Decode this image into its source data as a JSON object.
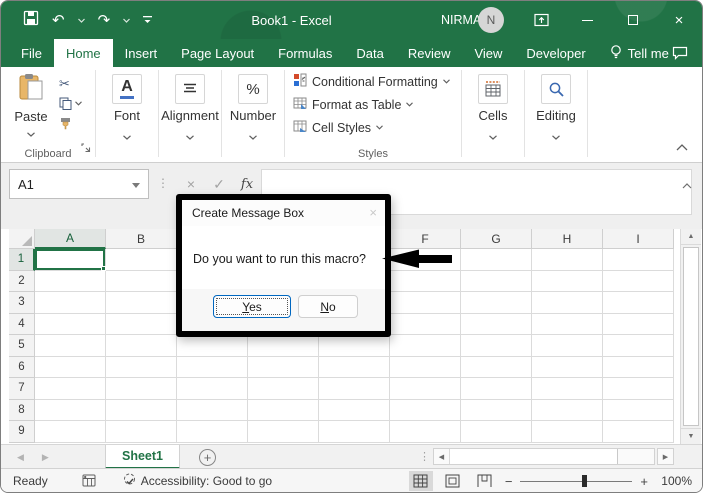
{
  "titlebar": {
    "title": "Book1 - Excel",
    "user": "NIRMAL",
    "avatar": "N"
  },
  "tabs": {
    "file": "File",
    "home": "Home",
    "insert": "Insert",
    "page_layout": "Page Layout",
    "formulas": "Formulas",
    "data": "Data",
    "review": "Review",
    "view": "View",
    "developer": "Developer",
    "tell_me": "Tell me"
  },
  "ribbon": {
    "paste": "Paste",
    "clipboard_group": "Clipboard",
    "font_icon_letter": "A",
    "font_group": "Font",
    "alignment_group": "Alignment",
    "number_icon": "%",
    "number_group": "Number",
    "conditional_formatting": "Conditional Formatting",
    "format_as_table": "Format as Table",
    "cell_styles": "Cell Styles",
    "styles_group": "Styles",
    "cells_group": "Cells",
    "editing_group": "Editing"
  },
  "formula_bar": {
    "name_box": "A1",
    "fx": "fx"
  },
  "dialog": {
    "title": "Create Message Box",
    "message": "Do you want to run this macro?",
    "yes_key": "Y",
    "yes_rest": "es",
    "no_key": "N",
    "no_rest": "o"
  },
  "grid": {
    "col_headers": [
      "A",
      "B",
      "",
      "",
      "",
      "F",
      "G",
      "H",
      "I"
    ],
    "row_headers": [
      "1",
      "2",
      "3",
      "4",
      "5",
      "6",
      "7",
      "8",
      "9"
    ],
    "selected_cell": "A1"
  },
  "sheet_bar": {
    "sheet_name": "Sheet1"
  },
  "status_bar": {
    "mode": "Ready",
    "accessibility": "Accessibility: Good to go",
    "zoom_level": "100%"
  },
  "icons": {
    "undo": "↶",
    "redo": "↷",
    "close": "×",
    "check": "✓",
    "cancel": "×",
    "scissors": "✂",
    "dots_v": "⋮",
    "tri_up": "▲",
    "tri_down": "▼",
    "tri_left": "◀",
    "tri_right": "▶",
    "plus": "+",
    "minus": "−"
  },
  "colors": {
    "excel_green": "#217346",
    "selection_border": "#217346",
    "annotation": "#000000"
  }
}
